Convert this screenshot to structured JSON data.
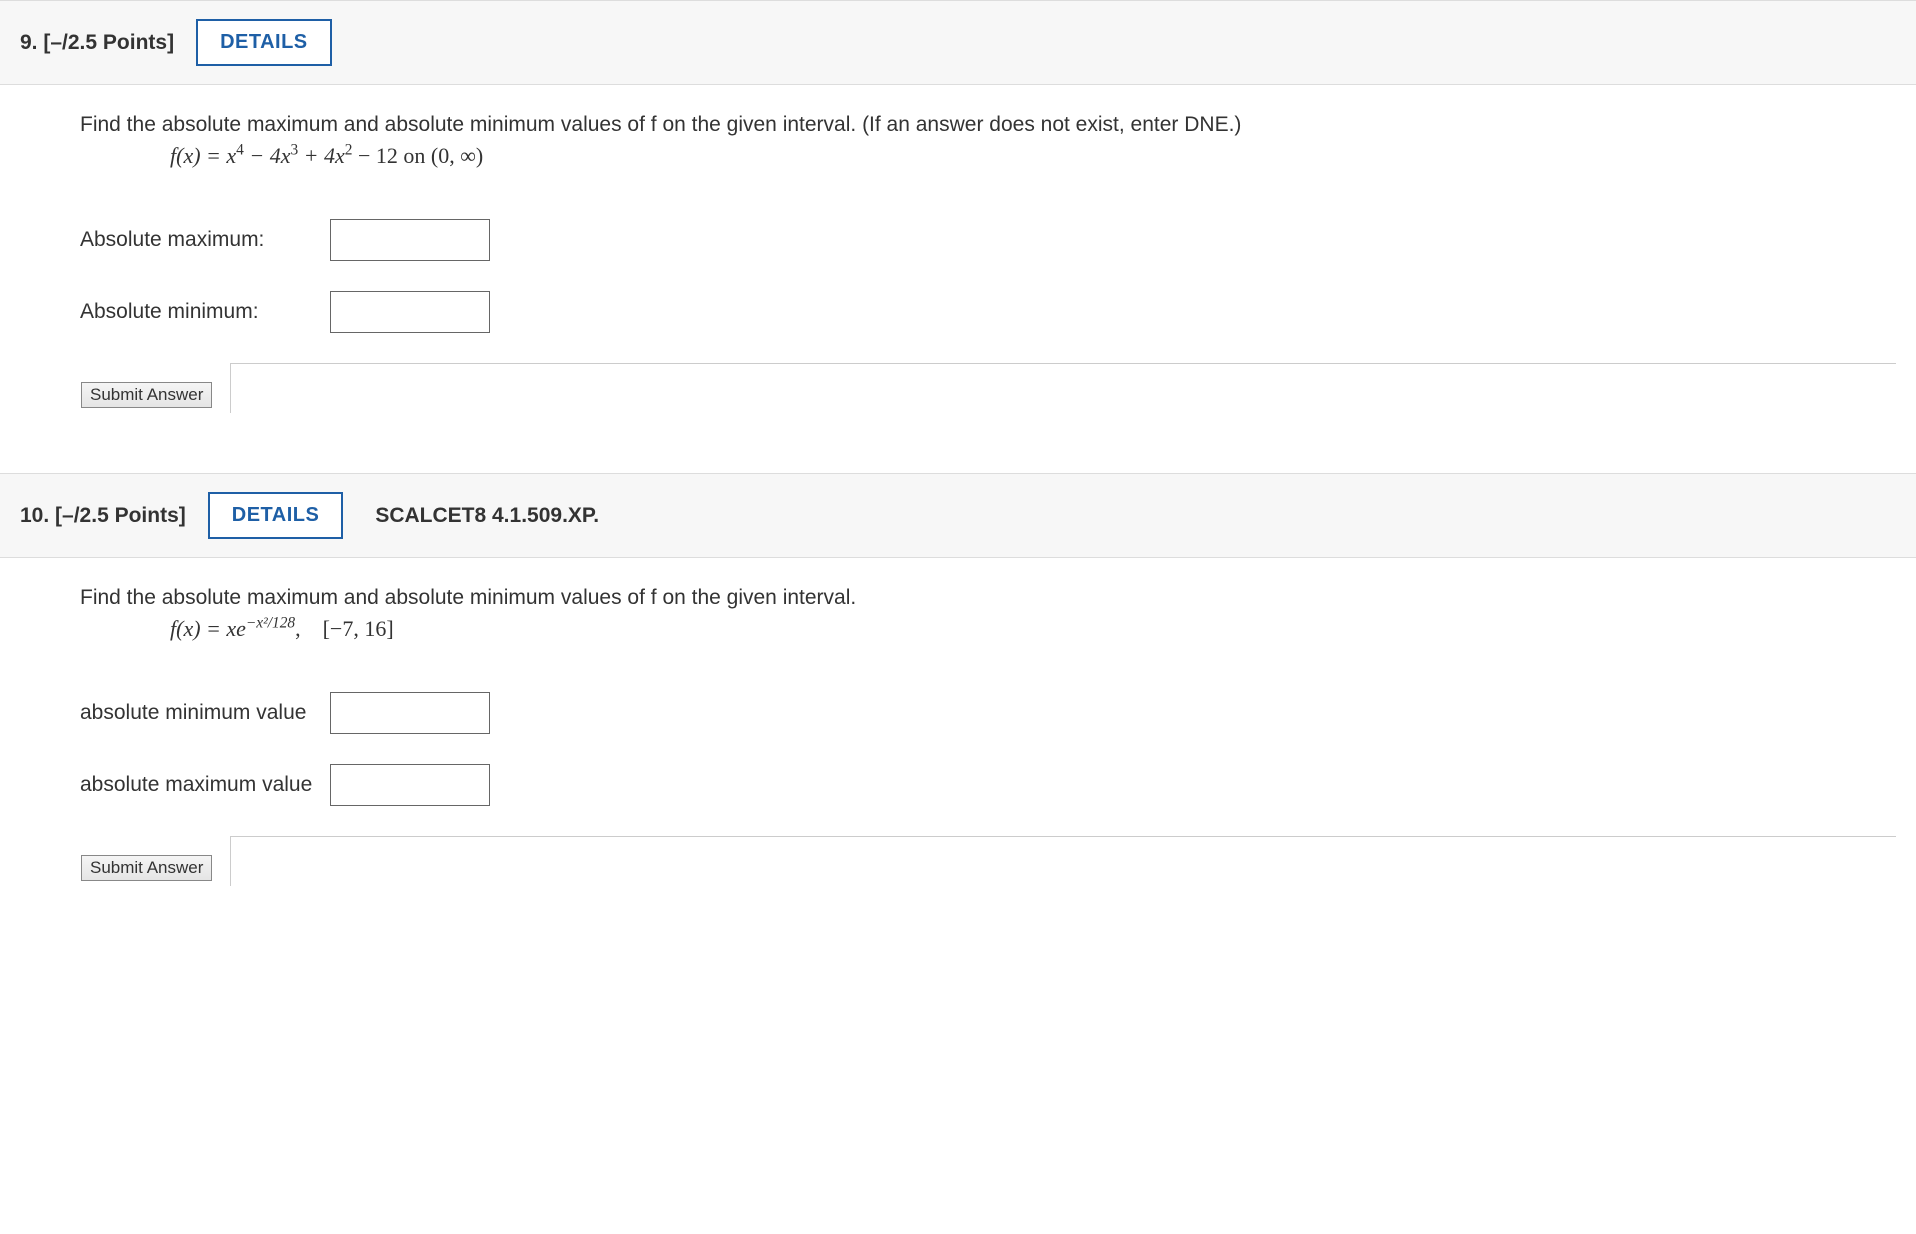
{
  "questions": [
    {
      "number": "9.",
      "points": "[–/2.5 Points]",
      "details_label": "DETAILS",
      "reference": "",
      "prompt": "Find the absolute maximum and absolute minimum values of f on the given interval. (If an answer does not exist, enter DNE.)",
      "formula_prefix": "f(x) = x",
      "formula_mid1": " − 4x",
      "formula_mid2": " + 4x",
      "formula_tail": " − 12  on (0, ∞)",
      "answers": [
        {
          "label": "Absolute maximum:",
          "value": ""
        },
        {
          "label": "Absolute minimum:",
          "value": ""
        }
      ],
      "submit_label": "Submit Answer"
    },
    {
      "number": "10.",
      "points": "[–/2.5 Points]",
      "details_label": "DETAILS",
      "reference": "SCALCET8 4.1.509.XP.",
      "prompt": "Find the absolute maximum and absolute minimum values of f on the given interval.",
      "formula2_prefix": "f(x) = xe",
      "formula2_exp": "−x²/128",
      "formula2_tail": ", [−7, 16]",
      "answers": [
        {
          "label": "absolute minimum value",
          "value": ""
        },
        {
          "label": "absolute maximum value",
          "value": ""
        }
      ],
      "submit_label": "Submit Answer"
    }
  ]
}
